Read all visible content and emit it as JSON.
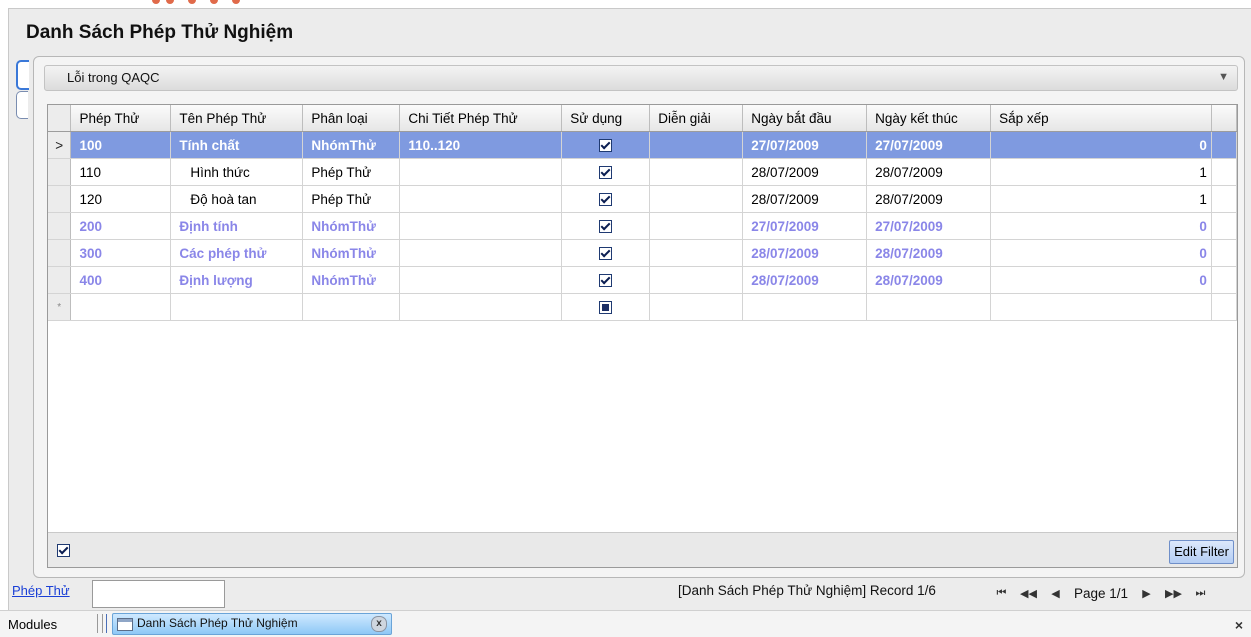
{
  "page_title": "Danh Sách Phép Thử Nghiệm",
  "group": {
    "title": "Lỗi trong QAQC",
    "caret": "▼"
  },
  "grid": {
    "columns": [
      "Phép Thử",
      "Tên Phép Thử",
      "Phân loại",
      "Chi Tiết Phép Thử",
      "Sử dụng",
      "Diễn giải",
      "Ngày bắt đầu",
      "Ngày kết thúc",
      "Sắp xếp"
    ],
    "current_row_marker": ">",
    "new_row_marker": "*",
    "rows": [
      {
        "code": "100",
        "name": "Tính chất",
        "type": "NhómThử",
        "detail": "110..120",
        "used": true,
        "desc": "",
        "start": "27/07/2009",
        "end": "27/07/2009",
        "sort": "0"
      },
      {
        "code": "110",
        "name": "Hình thức",
        "type": "Phép Thử",
        "detail": "",
        "used": true,
        "desc": "",
        "start": "28/07/2009",
        "end": "28/07/2009",
        "sort": "1"
      },
      {
        "code": "120",
        "name": "Độ hoà tan",
        "type": "Phép Thử",
        "detail": "",
        "used": true,
        "desc": "",
        "start": "28/07/2009",
        "end": "28/07/2009",
        "sort": "1"
      },
      {
        "code": "200",
        "name": "Định tính",
        "type": "NhómThử",
        "detail": "",
        "used": true,
        "desc": "",
        "start": "27/07/2009",
        "end": "27/07/2009",
        "sort": "0"
      },
      {
        "code": "300",
        "name": "Các phép thử",
        "type": "NhómThử",
        "detail": "",
        "used": true,
        "desc": "",
        "start": "28/07/2009",
        "end": "28/07/2009",
        "sort": "0"
      },
      {
        "code": "400",
        "name": "Định lượng",
        "type": "NhómThử",
        "detail": "",
        "used": true,
        "desc": "",
        "start": "28/07/2009",
        "end": "28/07/2009",
        "sort": "0"
      }
    ],
    "filter_checked": true,
    "edit_filter_label": "Edit Filter"
  },
  "statusbar": {
    "field_label": "Phép Thử",
    "field_value": "",
    "record_text": "[Danh Sách Phép Thử Nghiệm] Record 1/6",
    "page_text": "Page 1/1",
    "nav_first": "⏮",
    "nav_prev_page": "◀◀",
    "nav_prev": "◀",
    "nav_next": "▶",
    "nav_next_page": "▶▶",
    "nav_last": "⏭"
  },
  "taskbar": {
    "modules_label": "Modules",
    "tab_label": "Danh Sách Phép Thử Nghiệm",
    "tab_close": "x",
    "close_all": "×"
  },
  "colors": {
    "selected_row": "#7f9ae0",
    "group_row_text": "#8a86e8",
    "link": "#1a3fd6"
  }
}
